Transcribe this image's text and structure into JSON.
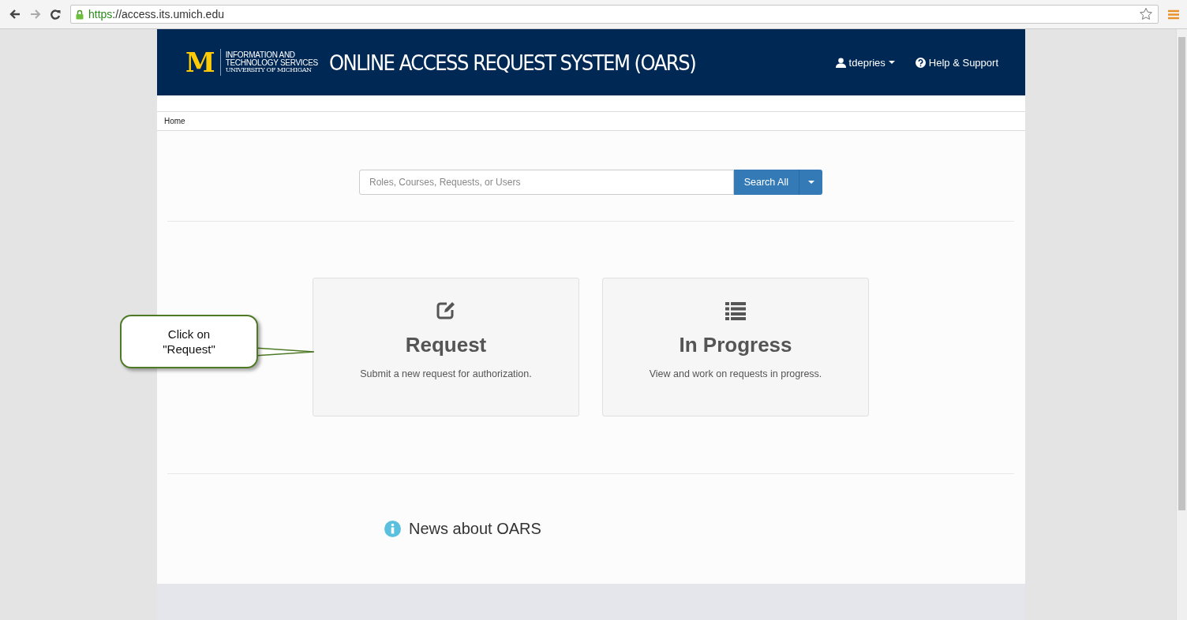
{
  "browser": {
    "url_scheme": "https",
    "url_rest": "://access.its.umich.edu"
  },
  "header": {
    "logo_mark": "M",
    "logo_lines": [
      "INFORMATION AND",
      "TECHNOLOGY SERVICES",
      "UNIVERSITY OF MICHIGAN"
    ],
    "title": "ONLINE ACCESS REQUEST SYSTEM (OARS)",
    "user": "tdepries",
    "help": "Help & Support"
  },
  "breadcrumb": [
    "Home"
  ],
  "search": {
    "placeholder": "Roles, Courses, Requests, or Users",
    "button": "Search All"
  },
  "cards": [
    {
      "kind": "request",
      "title": "Request",
      "description": "Submit a new request for authorization."
    },
    {
      "kind": "progress",
      "title": "In Progress",
      "description": "View and work on requests in progress."
    }
  ],
  "news": {
    "title": "News about OARS"
  },
  "callout": {
    "lines": [
      "Click on",
      "\"Request\""
    ]
  }
}
